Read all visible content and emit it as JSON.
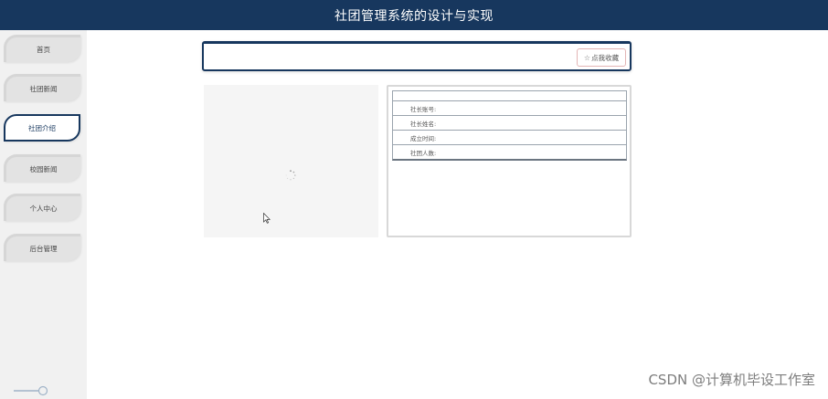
{
  "header": {
    "title": "社团管理系统的设计与实现"
  },
  "sidebar": {
    "items": [
      {
        "label": "首页",
        "active": false
      },
      {
        "label": "社团新闻",
        "active": false
      },
      {
        "label": "社团介绍",
        "active": true
      },
      {
        "label": "校园新闻",
        "active": false
      },
      {
        "label": "个人中心",
        "active": false
      },
      {
        "label": "后台管理",
        "active": false
      }
    ]
  },
  "search": {
    "fav_label": "点我收藏",
    "fav_icon": "star-outline-icon"
  },
  "info": {
    "rows": [
      {
        "label": "社长账号:"
      },
      {
        "label": "社长姓名:"
      },
      {
        "label": "成立时间:"
      },
      {
        "label": "社团人数:"
      }
    ]
  },
  "watermark": "CSDN @计算机毕设工作室",
  "colors": {
    "header_bg": "#17375e",
    "sidebar_bg": "#f1f1f1",
    "active_border": "#17375e"
  }
}
